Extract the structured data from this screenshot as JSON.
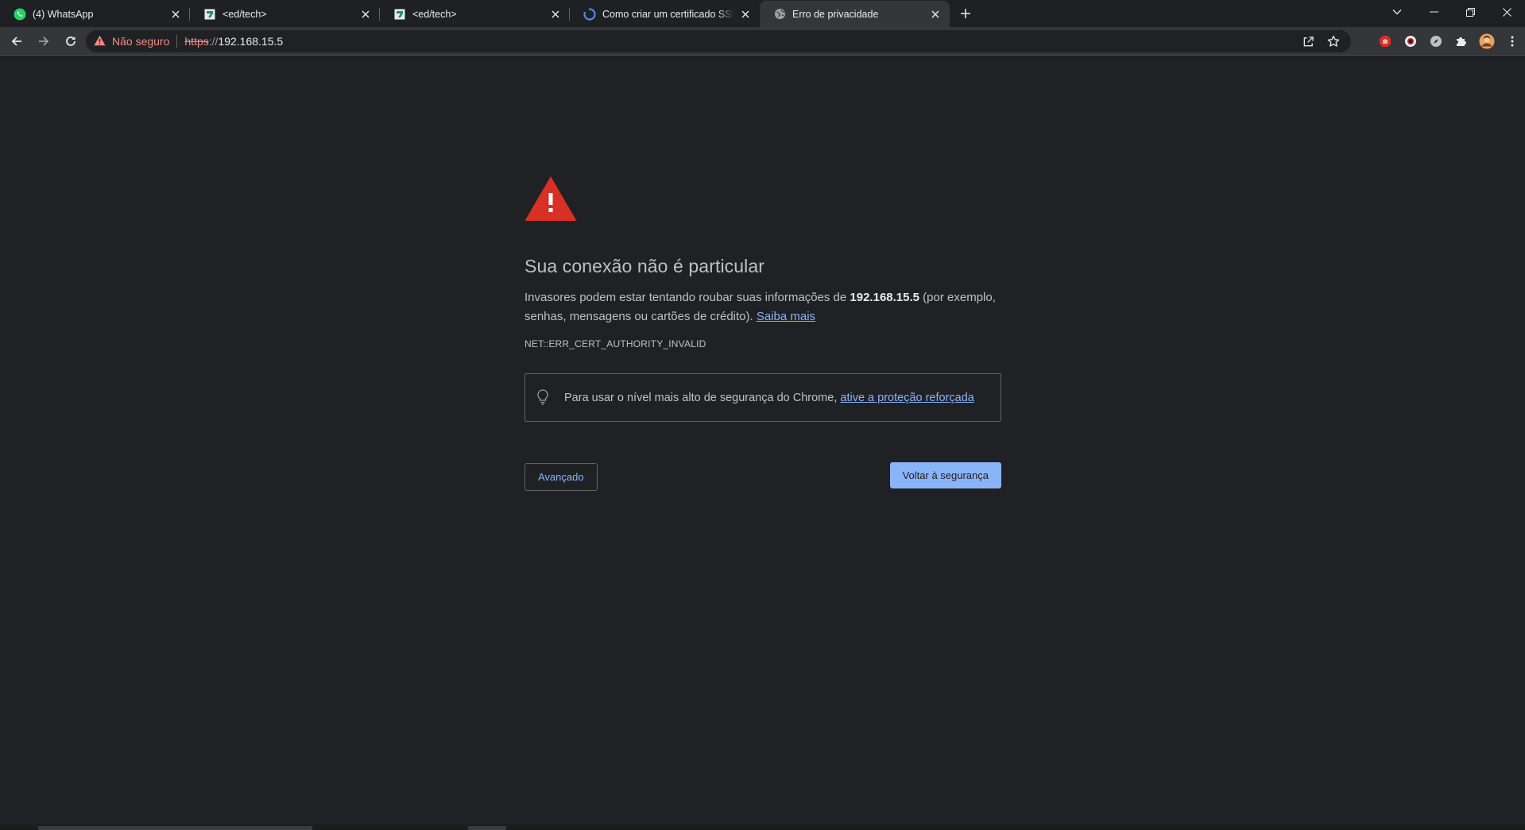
{
  "tabs": [
    {
      "title": "(4) WhatsApp",
      "icon": "whatsapp-icon",
      "active": false
    },
    {
      "title": "<ed/tech>",
      "icon": "edtech-icon",
      "active": false
    },
    {
      "title": "<ed/tech>",
      "icon": "edtech-icon",
      "active": false
    },
    {
      "title": "Como criar um certificado SSL auto-assinado",
      "icon": "loading-icon",
      "active": false
    },
    {
      "title": "Erro de privacidade",
      "icon": "globe-icon",
      "active": true
    }
  ],
  "toolbar": {
    "security_label": "Não seguro",
    "url_scheme": "https",
    "url_separator": "://",
    "url_host": "192.168.15.5"
  },
  "interstitial": {
    "heading": "Sua conexão não é particular",
    "desc_part1": "Invasores podem estar tentando roubar suas informações de ",
    "desc_host": "192.168.15.5",
    "desc_part2": " (por exemplo, senhas, mensagens ou cartões de crédito). ",
    "learn_more": "Saiba mais",
    "error_code": "NET::ERR_CERT_AUTHORITY_INVALID",
    "tip_text": "Para usar o nível mais alto de segurança do Chrome, ",
    "tip_link": "ative a proteção reforçada",
    "advanced_button": "Avançado",
    "back_button": "Voltar à segurança"
  },
  "colors": {
    "background": "#202124",
    "warning_red": "#d93025",
    "link_blue": "#8ab4f8",
    "not_secure_red": "#f28b82"
  }
}
